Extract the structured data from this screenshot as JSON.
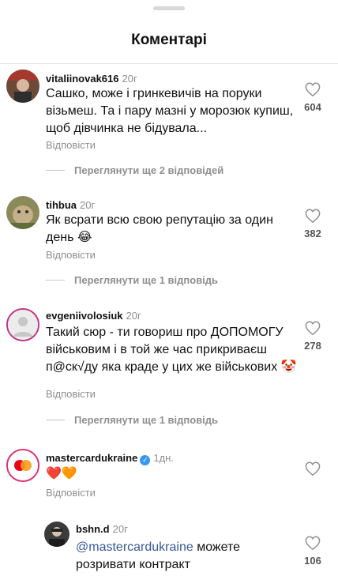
{
  "header": {
    "title": "Коментарі"
  },
  "reply_label": "Відповісти",
  "comments": [
    {
      "username": "vitaliinovak616",
      "time": "20г",
      "text": "Сашко, може і гринкевичів на поруки візьмеш. Та і пару мазні у морозюк купиш, щоб дівчинка не бідувала...",
      "likes": "604",
      "view_replies": "Переглянути ще 2 відповідей"
    },
    {
      "username": "tihbua",
      "time": "20г",
      "text": "Як всрати всю свою репутацію за один день 😂",
      "likes": "382",
      "view_replies": "Переглянути ще 1 відповідь"
    },
    {
      "username": "evgeniivolosiuk",
      "time": "20г",
      "text": "Такий сюр - ти говориш про ДОПОМОГУ військовим і в той же час прикриваєш п@ск√ду яка краде у цих же військових 🤡",
      "likes": "278",
      "view_replies": "Переглянути ще 1 відповідь"
    },
    {
      "username": "mastercardukraine",
      "time": "1дн.",
      "text": "❤️🧡",
      "likes": ""
    }
  ],
  "reply": {
    "username": "bshn.d",
    "time": "20г",
    "mention": "@mastercardukraine",
    "text": " можете розривати контракт",
    "likes": "106"
  },
  "colors": {
    "accent_blue": "#3897f0",
    "mention": "#385898",
    "muted": "#8e8e8e"
  }
}
